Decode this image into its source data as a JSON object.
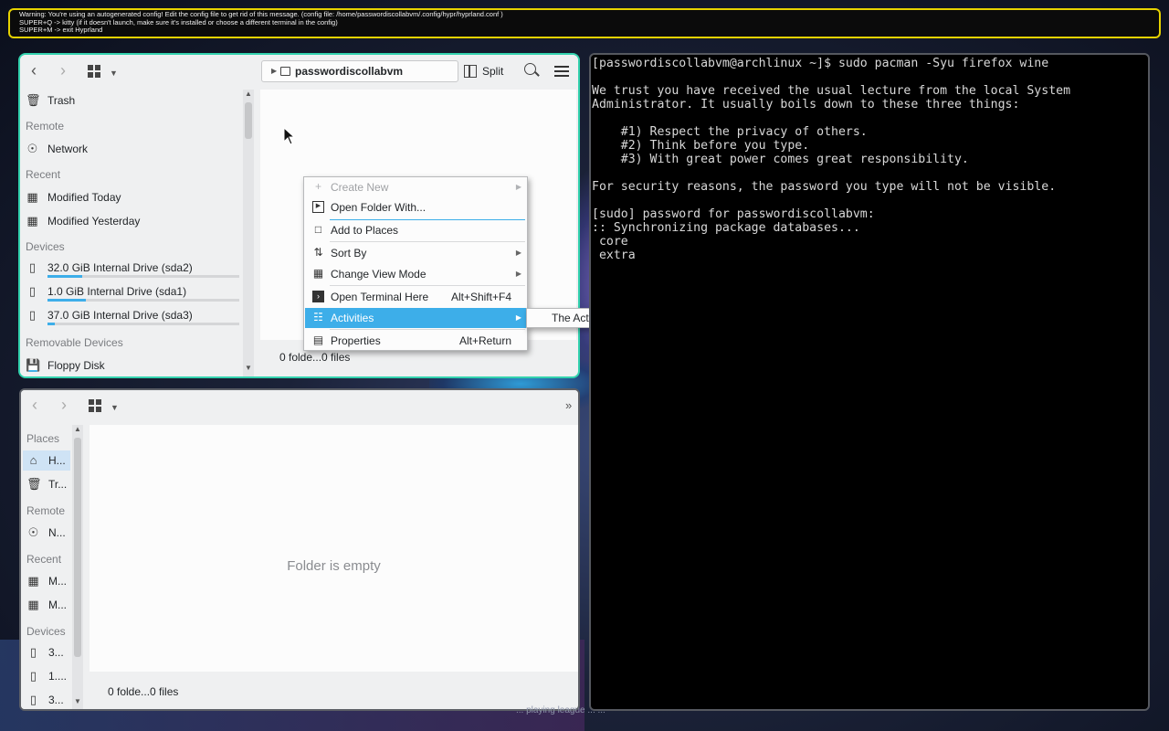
{
  "warning": {
    "lines": [
      "Warning: You're using an autogenerated config! Edit the config file to get rid of this message. (config file: /home/passwordiscollabvm/.config/hypr/hyprland.conf )",
      "SUPER+Q -> kitty (if it doesn't launch, make sure it's installed or choose a different terminal in the config)",
      "SUPER+M -> exit Hyprland"
    ]
  },
  "dolphin_top": {
    "breadcrumb": "passwordiscollabvm",
    "split_label": "Split",
    "sidebar": {
      "trash": "Trash",
      "remote_heading": "Remote",
      "network": "Network",
      "recent_heading": "Recent",
      "modified_today": "Modified Today",
      "modified_yesterday": "Modified Yesterday",
      "devices_heading": "Devices",
      "drives": [
        {
          "label": "32.0 GiB Internal Drive (sda2)",
          "usage": 0.18
        },
        {
          "label": "1.0 GiB Internal Drive (sda1)",
          "usage": 0.2
        },
        {
          "label": "37.0 GiB Internal Drive (sda3)",
          "usage": 0.04
        }
      ],
      "removable_heading": "Removable Devices",
      "floppy": "Floppy Disk"
    },
    "status": "0 folde...0 files"
  },
  "context_menu": {
    "create_new": "Create New",
    "open_folder_with": "Open Folder With...",
    "add_to_places": "Add to Places",
    "sort_by": "Sort By",
    "change_view_mode": "Change View Mode",
    "open_terminal_here": "Open Terminal Here",
    "open_terminal_shortcut": "Alt+Shift+F4",
    "activities": "Activities",
    "properties": "Properties",
    "properties_shortcut": "Alt+Return",
    "activities_submenu": "The Activity Manager is not running"
  },
  "dolphin_bottom": {
    "sidebar": {
      "places_heading": "Places",
      "home": "H...",
      "trash": "Tr...",
      "remote_heading": "Remote",
      "network": "N...",
      "recent_heading": "Recent",
      "modified_today": "M...",
      "modified_yesterday": "M...",
      "devices_heading": "Devices",
      "drive1": "3...",
      "drive2": "1....",
      "drive3": "3..."
    },
    "empty_message": "Folder is empty",
    "status": "0 folde...0 files"
  },
  "terminal": {
    "lines": [
      "[passwordiscollabvm@archlinux ~]$ sudo pacman -Syu firefox wine",
      "",
      "We trust you have received the usual lecture from the local System",
      "Administrator. It usually boils down to these three things:",
      "",
      "    #1) Respect the privacy of others.",
      "    #2) Think before you type.",
      "    #3) With great power comes great responsibility.",
      "",
      "For security reasons, the password you type will not be visible.",
      "",
      "[sudo] password for passwordiscollabvm:",
      ":: Synchronizing package databases...",
      " core",
      " extra"
    ]
  },
  "wallpaper_caption": "... playing league ... ..."
}
